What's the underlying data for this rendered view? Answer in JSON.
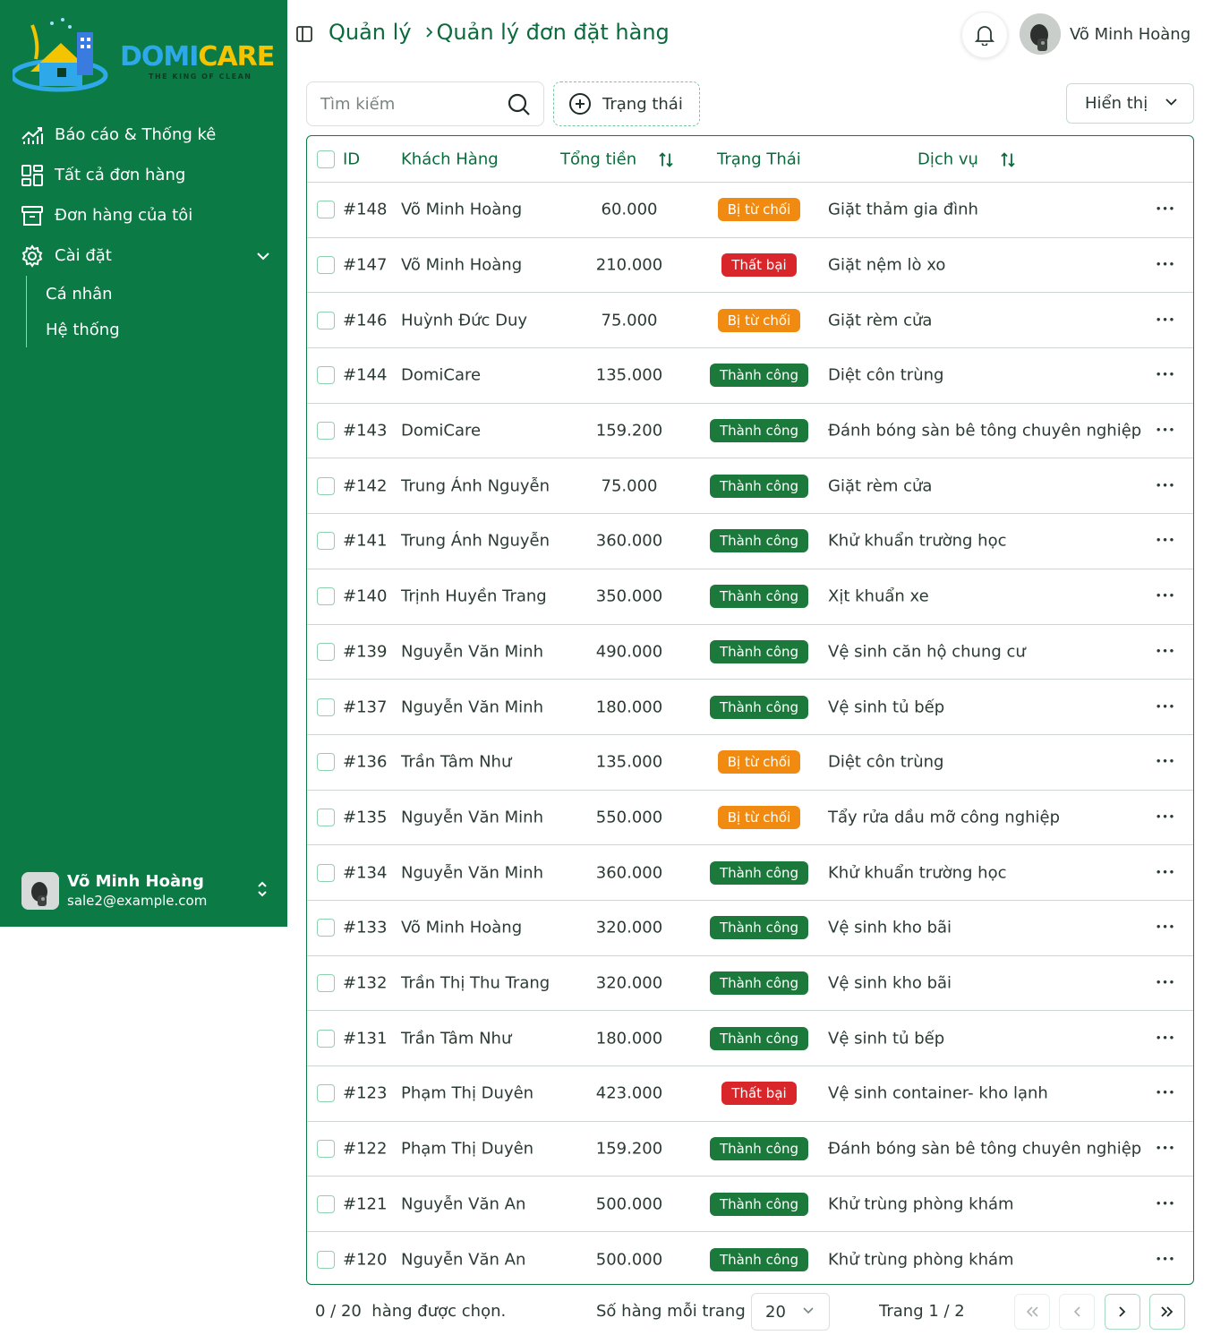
{
  "brand": {
    "word_part1": "DOMI",
    "word_part2": "CARE",
    "tagline": "THE KING OF CLEAN"
  },
  "sidebar": {
    "items": [
      {
        "label": "Báo cáo & Thống kê",
        "icon": "chart-icon"
      },
      {
        "label": "Tất cả đơn hàng",
        "icon": "grid-icon"
      },
      {
        "label": "Đơn hàng của tôi",
        "icon": "archive-icon"
      },
      {
        "label": "Cài đặt",
        "icon": "gear-icon"
      }
    ],
    "settings_sub": [
      {
        "label": "Cá nhân"
      },
      {
        "label": "Hệ thống"
      }
    ],
    "user": {
      "name": "Võ Minh Hoàng",
      "email": "sale2@example.com"
    }
  },
  "header": {
    "breadcrumb": {
      "root": "Quản lý",
      "current": "Quản lý đơn đặt hàng"
    },
    "user_name": "Võ Minh Hoàng"
  },
  "toolbar": {
    "search_placeholder": "Tìm kiếm",
    "status_filter_label": "Trạng thái",
    "display_label": "Hiển thị"
  },
  "table": {
    "columns": {
      "id": "ID",
      "customer": "Khách Hàng",
      "total": "Tổng tiền",
      "status": "Trạng Thái",
      "service": "Dịch vụ"
    },
    "status_colors": {
      "Bị từ chối": "#f08a10",
      "Thất bại": "#d9262a",
      "Thành công": "#1b7a3b"
    },
    "rows": [
      {
        "id": "#148",
        "customer": "Võ Minh Hoàng",
        "total": "60.000",
        "status": "Bị từ chối",
        "service": "Giặt thảm gia đình"
      },
      {
        "id": "#147",
        "customer": "Võ Minh Hoàng",
        "total": "210.000",
        "status": "Thất bại",
        "service": "Giặt nệm lò xo"
      },
      {
        "id": "#146",
        "customer": "Huỳnh Đức Duy",
        "total": "75.000",
        "status": "Bị từ chối",
        "service": "Giặt rèm cửa"
      },
      {
        "id": "#144",
        "customer": "DomiCare",
        "total": "135.000",
        "status": "Thành công",
        "service": "Diệt côn trùng"
      },
      {
        "id": "#143",
        "customer": "DomiCare",
        "total": "159.200",
        "status": "Thành công",
        "service": "Đánh bóng sàn bê tông chuyên nghiệp"
      },
      {
        "id": "#142",
        "customer": "Trung Ánh Nguyễn",
        "total": "75.000",
        "status": "Thành công",
        "service": "Giặt rèm cửa"
      },
      {
        "id": "#141",
        "customer": "Trung Ánh Nguyễn",
        "total": "360.000",
        "status": "Thành công",
        "service": "Khử khuẩn trường học"
      },
      {
        "id": "#140",
        "customer": "Trịnh Huyền Trang",
        "total": "350.000",
        "status": "Thành công",
        "service": "Xịt khuẩn xe"
      },
      {
        "id": "#139",
        "customer": "Nguyễn Văn Minh",
        "total": "490.000",
        "status": "Thành công",
        "service": "Vệ sinh căn hộ chung cư"
      },
      {
        "id": "#137",
        "customer": "Nguyễn Văn Minh",
        "total": "180.000",
        "status": "Thành công",
        "service": "Vệ sinh tủ bếp"
      },
      {
        "id": "#136",
        "customer": "Trần Tâm Như",
        "total": "135.000",
        "status": "Bị từ chối",
        "service": "Diệt côn trùng"
      },
      {
        "id": "#135",
        "customer": "Nguyễn Văn Minh",
        "total": "550.000",
        "status": "Bị từ chối",
        "service": "Tẩy rửa dầu mỡ công nghiệp"
      },
      {
        "id": "#134",
        "customer": "Nguyễn Văn Minh",
        "total": "360.000",
        "status": "Thành công",
        "service": "Khử khuẩn trường học"
      },
      {
        "id": "#133",
        "customer": "Võ Minh Hoàng",
        "total": "320.000",
        "status": "Thành công",
        "service": "Vệ sinh kho bãi"
      },
      {
        "id": "#132",
        "customer": "Trần Thị Thu Trang",
        "total": "320.000",
        "status": "Thành công",
        "service": "Vệ sinh kho bãi"
      },
      {
        "id": "#131",
        "customer": "Trần Tâm Như",
        "total": "180.000",
        "status": "Thành công",
        "service": "Vệ sinh tủ bếp"
      },
      {
        "id": "#123",
        "customer": "Phạm Thị Duyên",
        "total": "423.000",
        "status": "Thất bại",
        "service": "Vệ sinh container- kho lạnh"
      },
      {
        "id": "#122",
        "customer": "Phạm Thị Duyên",
        "total": "159.200",
        "status": "Thành công",
        "service": "Đánh bóng sàn bê tông chuyên nghiệp"
      },
      {
        "id": "#121",
        "customer": "Nguyễn Văn An",
        "total": "500.000",
        "status": "Thành công",
        "service": "Khử trùng phòng khám"
      },
      {
        "id": "#120",
        "customer": "Nguyễn Văn An",
        "total": "500.000",
        "status": "Thành công",
        "service": "Khử trùng phòng khám"
      }
    ]
  },
  "footer": {
    "selection": "0 / 20  hàng được chọn.",
    "rows_per_page_label": "Số hàng mỗi trang",
    "rows_per_page_value": "20",
    "page_info": "Trang 1 / 2"
  }
}
